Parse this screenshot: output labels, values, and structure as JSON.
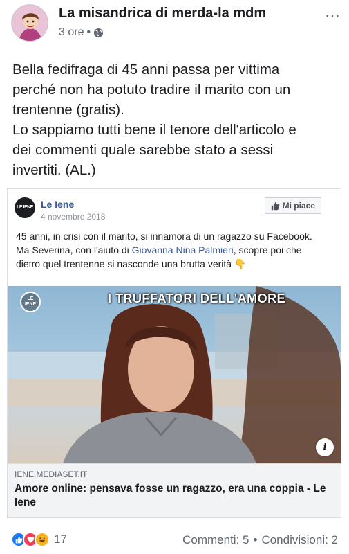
{
  "post": {
    "author": "La misandrica di merda-la mdm",
    "time": "3 ore",
    "separator": "•",
    "more_icon": "⋯",
    "text_lines": [
      "Bella fedifraga di 45 anni passa per vittima",
      "perché non ha potuto tradire il marito con un",
      "trentenne (gratis).",
      "Lo sappiamo tutti bene il tenore dell'articolo e",
      "dei commenti quale sarebbe stato a sessi",
      "invertiti.  (AL.)"
    ]
  },
  "shared": {
    "logo_text": "LE IENE",
    "page_name": "Le Iene",
    "date": "4 novembre 2018",
    "like_button": "Mi piace",
    "text_line1": "45 anni, in crisi con il marito, si innamora di un ragazzo su Facebook.",
    "text_line2_before": "Ma Severina, con l'aiuto di ",
    "text_mention": "Giovanna Nina Palmieri",
    "text_line2_after": ", scopre poi che",
    "text_line3": "dietro quel trentenne si nasconde una brutta verità 👇",
    "image_logo": "LE IENE",
    "image_caption": "I TRUFFATORI DELL'AMORE",
    "info_icon": "i",
    "link_domain": "IENE.MEDIASET.IT",
    "link_title": "Amore online: pensava fosse un ragazzo, era una coppia - Le Iene"
  },
  "footer": {
    "reaction_count": "17",
    "comments": "Commenti: 5",
    "dot": "•",
    "shares": "Condivisioni: 2"
  },
  "colors": {
    "link_blue": "#365899",
    "like_blue": "#1877f2",
    "love_red": "#f33e58",
    "haha_yellow": "#f7b125",
    "muted": "#606770"
  },
  "icons": [
    "avatar",
    "globe-icon",
    "more-icon",
    "thumbs-up-icon",
    "info-icon",
    "like-reaction-icon",
    "love-reaction-icon",
    "haha-reaction-icon"
  ]
}
